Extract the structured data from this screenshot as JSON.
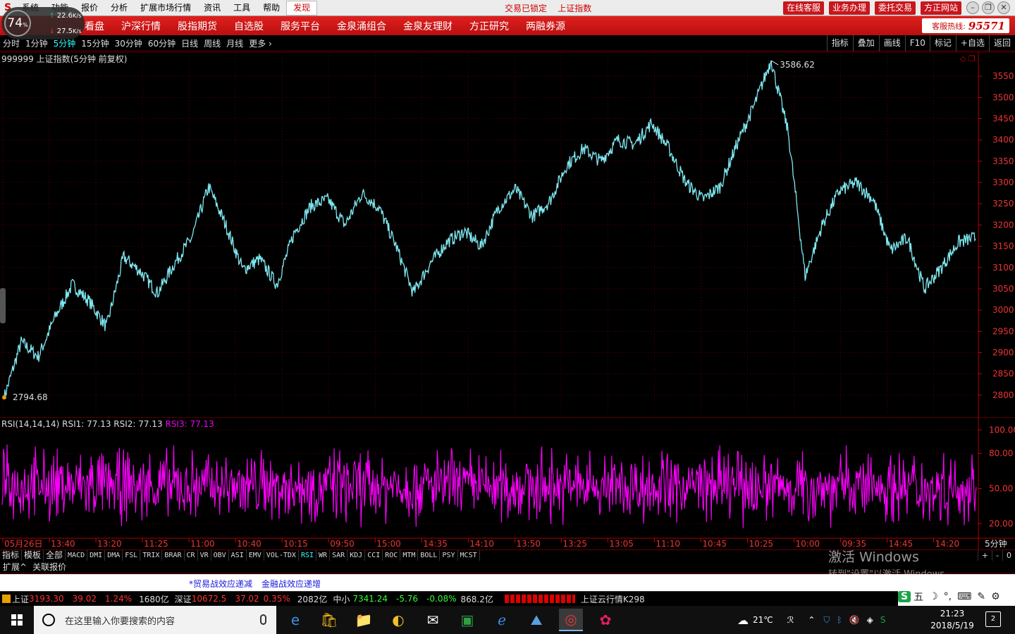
{
  "menu": {
    "items": [
      "系统",
      "功能",
      "报价",
      "分析",
      "扩展市场行情",
      "资讯",
      "工具",
      "帮助"
    ],
    "found_label": "发现",
    "center_text": "交易已锁定",
    "center_name": "上证指数",
    "right_buttons": [
      "在线客服",
      "业务办理",
      "委托交易",
      "方正网站"
    ]
  },
  "network": {
    "percent": "74",
    "percent_unit": "%",
    "up_speed": "22.6",
    "down_speed": "27.5",
    "unit": "K/s"
  },
  "nav": {
    "items": [
      "看盘",
      "沪深行情",
      "股指期货",
      "自选股",
      "服务平台",
      "金泉涌组合",
      "金泉友理财",
      "方正研究",
      "两融券源"
    ],
    "hotline_label": "客服热线:",
    "hotline_number": "95571"
  },
  "periods": {
    "items": [
      "分时",
      "1分钟",
      "5分钟",
      "15分钟",
      "30分钟",
      "60分钟",
      "日线",
      "周线",
      "月线",
      "更多"
    ],
    "active": "5分钟",
    "right_tools": [
      "指标",
      "叠加",
      "画线",
      "F10",
      "标记",
      "+自选",
      "返回"
    ]
  },
  "chart_title": "999999 上证指数(5分钟 前复权)",
  "rsi_legend": {
    "name": "RSI(14,14,14)",
    "rsi1": "RSI1: 77.13",
    "rsi2": "RSI2: 77.13",
    "rsi3": "RSI3: 77.13"
  },
  "chart_data": [
    {
      "type": "line",
      "title": "999999 上证指数(5分钟 前复权)",
      "color": "#7ee8f0",
      "ylim": [
        2770,
        3590
      ],
      "yticks": [
        2800,
        2850,
        2900,
        2950,
        3000,
        3050,
        3100,
        3150,
        3200,
        3250,
        3300,
        3350,
        3400,
        3450,
        3500,
        3550
      ],
      "x": [
        "05月26日",
        "13:40",
        "13:20",
        "11:25",
        "11:00",
        "10:40",
        "10:15",
        "09:50",
        "15:00",
        "14:35",
        "14:10",
        "13:50",
        "13:25",
        "13:05",
        "11:10",
        "10:45",
        "10:25",
        "10:00",
        "09:35",
        "14:45",
        "14:20"
      ],
      "y_keypoints": [
        2794.68,
        2925,
        2890,
        2985,
        3060,
        3020,
        2960,
        3125,
        3090,
        3040,
        3110,
        3170,
        3290,
        3200,
        3095,
        3120,
        3060,
        3180,
        3245,
        3260,
        3200,
        3275,
        3240,
        3150,
        3040,
        3110,
        3160,
        3185,
        3150,
        3240,
        3285,
        3220,
        3255,
        3340,
        3380,
        3350,
        3400,
        3390,
        3440,
        3380,
        3300,
        3260,
        3290,
        3390,
        3480,
        3586.62,
        3420,
        3080,
        3200,
        3280,
        3300,
        3260,
        3140,
        3170,
        3050,
        3100,
        3160,
        3170
      ],
      "max_label": "3586.62",
      "min_label": "2794.68"
    },
    {
      "type": "line",
      "title": "RSI(14,14,14)",
      "color": "#ff00ff",
      "ylim": [
        10,
        105
      ],
      "yticks": [
        20.0,
        50.0,
        80.0,
        100.0
      ],
      "series_names": [
        "RSI1",
        "RSI2",
        "RSI3"
      ],
      "last_value": 77.13,
      "mean": 52,
      "range": [
        15,
        85
      ]
    }
  ],
  "current_period": "5分钟",
  "indicators": {
    "items": [
      "指标",
      "模板",
      "全部",
      "MACD",
      "DMI",
      "DMA",
      "FSL",
      "TRIX",
      "BRAR",
      "CR",
      "VR",
      "OBV",
      "ASI",
      "EMV",
      "VOL-TDX",
      "RSI",
      "WR",
      "SAR",
      "KDJ",
      "CCI",
      "ROC",
      "MTM",
      "BOLL",
      "PSY",
      "MCST"
    ],
    "active": "RSI",
    "zoom": [
      "+",
      "-",
      "0"
    ]
  },
  "ext_tabs": [
    "扩展^",
    "关联报价"
  ],
  "watermark": {
    "line1": "激活 Windows",
    "line2": "转到\"设置\"以激活 Windows。"
  },
  "news": [
    "*贸易战效应递减",
    "金融战效应递增"
  ],
  "status": {
    "sh_label": "上证",
    "sh_value": "3193.30",
    "sh_change": "39.02",
    "sh_pct": "1.24%",
    "sh_vol": "1680亿",
    "sz_label": "深证",
    "sz_value": "10672.5",
    "sz_change": "37.02",
    "sz_pct": "0.35%",
    "sz_vol": "2082亿",
    "zx_label": "中小",
    "zx_value": "7341.24",
    "zx_change": "-5.76",
    "zx_pct": "-0.08%",
    "zx_vol": "868.2亿",
    "cloud": "上证云行情K298"
  },
  "ime": [
    "S",
    "五",
    "☽",
    "°,",
    "⌨",
    "✎",
    "⚙"
  ],
  "taskbar": {
    "search_placeholder": "在这里输入你要搜索的内容",
    "weather": "21℃",
    "time": "21:23",
    "date": "2018/5/19",
    "notifications": "2"
  }
}
